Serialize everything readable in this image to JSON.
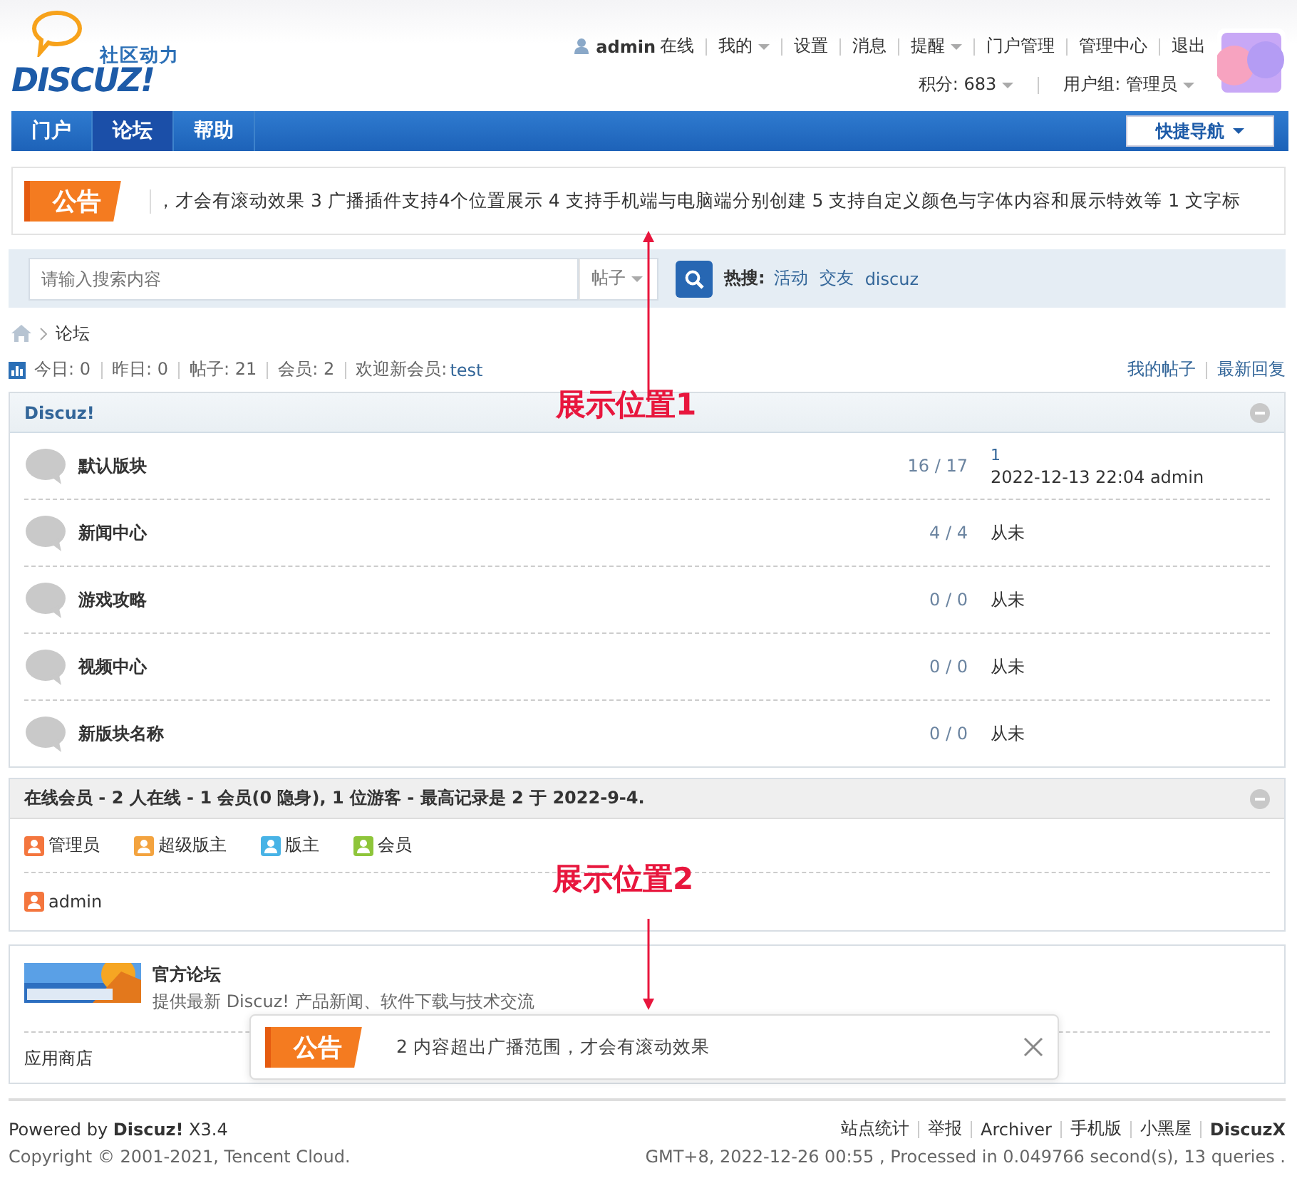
{
  "logo": {
    "tagline": "社区动力",
    "wordmark": "DISCUZ!"
  },
  "user_bar": {
    "username": "admin",
    "status": "在线",
    "links": [
      {
        "label": "我的",
        "dropdown": true
      },
      {
        "label": "设置",
        "dropdown": false
      },
      {
        "label": "消息",
        "dropdown": false
      },
      {
        "label": "提醒",
        "dropdown": true
      },
      {
        "label": "门户管理",
        "dropdown": false
      },
      {
        "label": "管理中心",
        "dropdown": false
      },
      {
        "label": "退出",
        "dropdown": false
      }
    ],
    "points": "积分: 683",
    "group": "用户组: 管理员"
  },
  "nav": {
    "items": [
      {
        "label": "门户",
        "selected": false
      },
      {
        "label": "论坛",
        "selected": true
      },
      {
        "label": "帮助",
        "selected": false
      }
    ],
    "quick_nav": "快捷导航"
  },
  "announcement": {
    "badge": "公告",
    "ticker": "，才会有滚动效果  3 广播插件支持4个位置展示  4 支持手机端与电脑端分别创建  5 支持自定义颜色与字体内容和展示特效等  1 文字标"
  },
  "search": {
    "placeholder": "请输入搜索内容",
    "scope": "帖子",
    "hot_label": "热搜:",
    "hot": [
      "活动",
      "交友",
      "discuz"
    ]
  },
  "breadcrumb": [
    "论坛"
  ],
  "stats": {
    "items": [
      "今日: 0",
      "昨日: 0",
      "帖子: 21",
      "会员: 2"
    ],
    "welcome": "欢迎新会员:",
    "new_member": "test",
    "links": [
      "我的帖子",
      "最新回复"
    ]
  },
  "forum_group": {
    "title": "Discuz!",
    "forums": [
      {
        "name": "默认版块",
        "counts": "16 / 17",
        "last_post": {
          "kind": "post",
          "title": "1",
          "meta": "2022-12-13 22:04 admin"
        }
      },
      {
        "name": "新闻中心",
        "counts": "4 / 4",
        "last_post": {
          "kind": "none",
          "text": "从未"
        }
      },
      {
        "name": "游戏攻略",
        "counts": "0 / 0",
        "last_post": {
          "kind": "none",
          "text": "从未"
        }
      },
      {
        "name": "视频中心",
        "counts": "0 / 0",
        "last_post": {
          "kind": "none",
          "text": "从未"
        }
      },
      {
        "name": "新版块名称",
        "counts": "0 / 0",
        "last_post": {
          "kind": "none",
          "text": "从未"
        }
      }
    ]
  },
  "online": {
    "title": "在线会员 - 2 人在线 - 1 会员(0 隐身), 1 位游客 - 最高记录是 2 于 2022-9-4.",
    "legend": [
      {
        "label": "管理员",
        "color": "#f4763e"
      },
      {
        "label": "超级版主",
        "color": "#f3a33f"
      },
      {
        "label": "版主",
        "color": "#48b3e6"
      },
      {
        "label": "会员",
        "color": "#8ec53a"
      }
    ],
    "members": [
      {
        "name": "admin",
        "color": "#f4763e"
      }
    ]
  },
  "apps": {
    "title": "官方论坛",
    "description": "提供最新 Discuz! 产品新闻、软件下载与技术交流",
    "store": "应用商店"
  },
  "annotations": [
    {
      "label": "展示位置1"
    },
    {
      "label": "展示位置2"
    }
  ],
  "popup": {
    "badge": "公告",
    "text": "2 内容超出广播范围，才会有滚动效果"
  },
  "footer": {
    "powered_prefix": "Powered by",
    "powered_brand": "Discuz!",
    "version": "X3.4",
    "copyright": "Copyright © 2001-2021, Tencent Cloud.",
    "links": [
      "站点统计",
      "举报",
      "Archiver",
      "手机版",
      "小黑屋",
      "DiscuzX"
    ],
    "processed": "GMT+8, 2022-12-26 00:55 , Processed in 0.049766 second(s), 13 queries ."
  }
}
